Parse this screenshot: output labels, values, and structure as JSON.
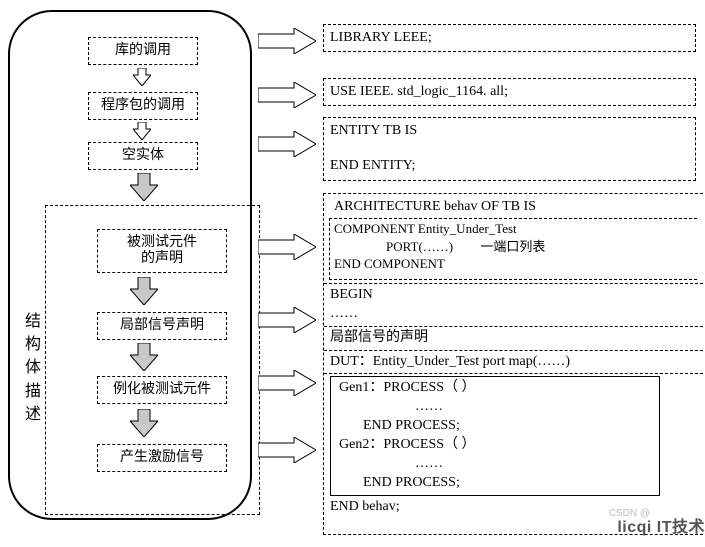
{
  "left": {
    "b1": "库的调用",
    "b2": "程序包的调用",
    "b3": "空实体",
    "vlabel": "结构体描述",
    "g1_l1": "被测试元件",
    "g1_l2": "的声明",
    "g2": "局部信号声明",
    "g3": "例化被测试元件",
    "g4": "产生激励信号"
  },
  "right": {
    "r1": "LIBRARY LEEE;",
    "r2": "USE IEEE. std_logic_1164. all;",
    "r3_l1": "ENTITY TB IS",
    "r3_l2": "END ENTITY;",
    "arch_l1": "ARCHITECTURE behav OF TB IS",
    "comp_l1": "COMPONENT Entity_Under_Test",
    "comp_l2a": "PORT(……)",
    "comp_l2b": "一端口列表",
    "comp_l3": "END COMPONENT",
    "begin_l1": "BEGIN",
    "begin_l2": "……",
    "sig_decl": "局部信号的声明",
    "dut": "DUT：Entity_Under_Test port map(……)",
    "proc_l1": "Gen1：PROCESS（ ）",
    "proc_l2": "……",
    "proc_l3": "END PROCESS;",
    "proc_l4": "Gen2：PROCESS（ ）",
    "proc_l5": "……",
    "proc_l6": "END PROCESS;",
    "end_behav": "END behav;"
  },
  "watermark": "licqi  IT技术",
  "wm_faint": "CSDN @"
}
